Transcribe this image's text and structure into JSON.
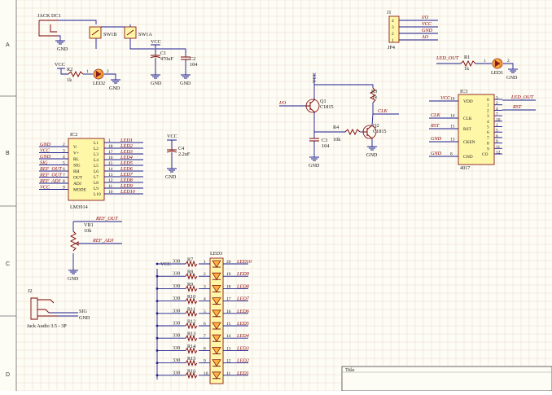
{
  "zones": [
    "A",
    "B",
    "C",
    "D"
  ],
  "title_block": {
    "title_label": "Title"
  },
  "power": {
    "jack": "JACK DC1",
    "sw1b": "SW1B",
    "sw1a": "SW1A",
    "c1_ref": "C1",
    "c1_val": "470uF",
    "c2_ref": "C2",
    "c2_val": "104",
    "vcc": "VCC",
    "gnd": "GND"
  },
  "led_vcc": {
    "r_ref": "R2",
    "r_val": "1k",
    "led_ref": "LED2",
    "pin1": "1",
    "pin2": "2"
  },
  "j1": {
    "ref": "J1",
    "footprint": "JP4",
    "pins": [
      "4",
      "3",
      "2",
      "1"
    ],
    "nets": [
      "I/O",
      "VCC",
      "GND",
      "AO"
    ]
  },
  "led_out": {
    "net": "LED_OUT",
    "r_ref": "R1",
    "r_val": "1k",
    "led_ref": "LED1",
    "pin1": "1",
    "pin2": "2"
  },
  "transistors": {
    "io_net": "I/O",
    "q1_ref": "Q1",
    "q1_part": "C1815",
    "q2_ref": "Q2",
    "q2_part": "C1815",
    "r3_ref": "R3",
    "r3_val": "1k",
    "r4_ref": "R4",
    "r4_val": "10k",
    "c3_ref": "C3",
    "c3_val": "104",
    "clk_net": "CLK",
    "vcc": "VCC",
    "gnd": "GND"
  },
  "ic3": {
    "ref": "IC3",
    "part": "4017",
    "left_pins": [
      {
        "num": "16",
        "name": "VDD",
        "net": "VCC"
      },
      {
        "num": "14",
        "name": "CLK",
        "net": "CLK"
      },
      {
        "num": "15",
        "name": "RST",
        "net": "RST"
      },
      {
        "num": "13",
        "name": "CKEN",
        "net": "GND"
      },
      {
        "num": "8",
        "name": "GND",
        "net": "GND"
      }
    ],
    "outputs": [
      "0",
      "1",
      "2",
      "3",
      "4",
      "5",
      "6",
      "7",
      "8",
      "9",
      "CO"
    ],
    "out_pins": [
      "3",
      "2",
      "4",
      "7",
      "10",
      "1",
      "5",
      "6",
      "9",
      "11",
      "12"
    ],
    "right_nets": [
      "LED_OUT",
      "RST"
    ]
  },
  "ic2": {
    "ref": "IC2",
    "part": "LM3914",
    "left_pins": [
      {
        "net": "GND",
        "num": "2",
        "name": "V-"
      },
      {
        "net": "VCC",
        "num": "3",
        "name": "V+"
      },
      {
        "net": "GND",
        "num": "4",
        "name": "RL"
      },
      {
        "net": "SIG",
        "num": "5",
        "name": "SIG"
      },
      {
        "net": "REF_OUT",
        "num": "6",
        "name": "RH"
      },
      {
        "net": "REF_OUT",
        "num": "7",
        "name": "OUT"
      },
      {
        "net": "REF_ADJ",
        "num": "8",
        "name": "ADJ"
      },
      {
        "net": "VCC",
        "num": "9",
        "name": "MODE"
      }
    ],
    "right_pins": [
      {
        "name": "L1",
        "num": "1",
        "net": "LED1"
      },
      {
        "name": "L2",
        "num": "18",
        "net": "LED2"
      },
      {
        "name": "L3",
        "num": "17",
        "net": "LED3"
      },
      {
        "name": "L4",
        "num": "16",
        "net": "LED4"
      },
      {
        "name": "L5",
        "num": "15",
        "net": "LED5"
      },
      {
        "name": "L6",
        "num": "14",
        "net": "LED6"
      },
      {
        "name": "L7",
        "num": "13",
        "net": "LED7"
      },
      {
        "name": "L8",
        "num": "12",
        "net": "LED8"
      },
      {
        "name": "L9",
        "num": "11",
        "net": "LED9"
      },
      {
        "name": "L10",
        "num": "10",
        "net": "LED10"
      }
    ]
  },
  "c4": {
    "vcc": "VCC",
    "ref": "C4",
    "val": "2.2uF",
    "gnd": "GND"
  },
  "vr1": {
    "ref": "VR1",
    "val": "10k",
    "net_top": "REF_OUT",
    "net_wiper": "REF_ADJ",
    "gnd": "GND"
  },
  "j2": {
    "ref": "J2",
    "part": "Jack Audio 3.5 - 3P",
    "sig": "SIG",
    "gnd": "GND"
  },
  "led_bar": {
    "ref": "LED3",
    "vcc": "VCC",
    "rows": [
      {
        "res_ref": "R7",
        "res_val": "330",
        "pin_l": "1",
        "pin_r": "20",
        "net": "LED10"
      },
      {
        "res_ref": "R8",
        "res_val": "330",
        "pin_l": "2",
        "pin_r": "19",
        "net": "LED9"
      },
      {
        "res_ref": "R9",
        "res_val": "330",
        "pin_l": "3",
        "pin_r": "18",
        "net": "LED8"
      },
      {
        "res_ref": "R10",
        "res_val": "330",
        "pin_l": "4",
        "pin_r": "17",
        "net": "LED7"
      },
      {
        "res_ref": "R11",
        "res_val": "330",
        "pin_l": "5",
        "pin_r": "16",
        "net": "LED6"
      },
      {
        "res_ref": "R12",
        "res_val": "330",
        "pin_l": "6",
        "pin_r": "15",
        "net": "LED5"
      },
      {
        "res_ref": "R13",
        "res_val": "330",
        "pin_l": "7",
        "pin_r": "14",
        "net": "LED4"
      },
      {
        "res_ref": "R14",
        "res_val": "330",
        "pin_l": "8",
        "pin_r": "13",
        "net": "LED3"
      },
      {
        "res_ref": "R15",
        "res_val": "330",
        "pin_l": "9",
        "pin_r": "12",
        "net": "LED2"
      },
      {
        "res_ref": "R16",
        "res_val": "330",
        "pin_l": "10",
        "pin_r": "11",
        "net": "LED1"
      }
    ]
  }
}
